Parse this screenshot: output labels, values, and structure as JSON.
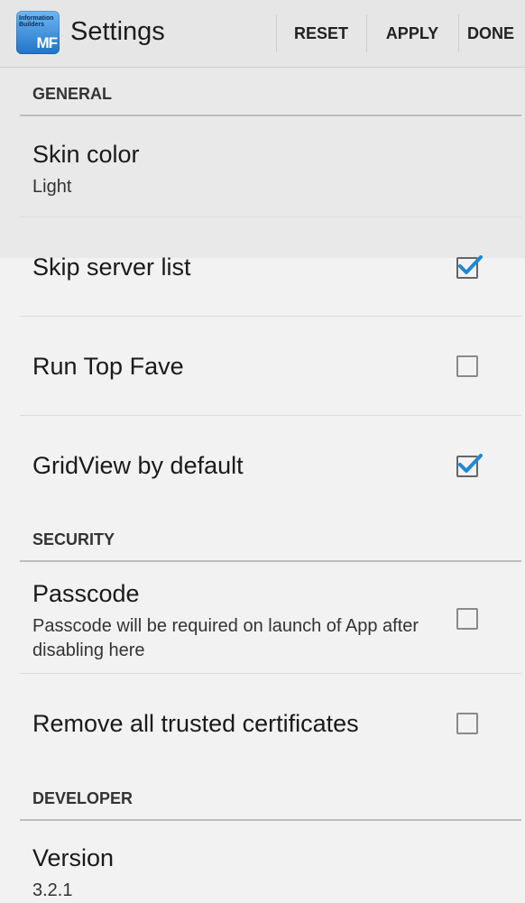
{
  "actionbar": {
    "title": "Settings",
    "icon": "information-builders-mf-icon",
    "icon_text_top": "Information Builders",
    "icon_text_mf": "MF",
    "actions": [
      "RESET",
      "APPLY",
      "DONE"
    ]
  },
  "colors": {
    "accent": "#1e88d6",
    "background": "#f2f2f2",
    "actionbar": "#e6e6e6"
  },
  "sections": [
    {
      "header": "GENERAL",
      "items": [
        {
          "title": "Skin color",
          "summary": "Light"
        },
        {
          "title": "Skip server list",
          "checked": true
        },
        {
          "title": "Run Top Fave",
          "checked": false
        },
        {
          "title": "GridView by default",
          "checked": true
        }
      ]
    },
    {
      "header": "SECURITY",
      "items": [
        {
          "title": "Passcode",
          "summary": "Passcode will be required on launch of App after disabling here",
          "checked": false
        },
        {
          "title": "Remove all trusted certificates",
          "checked": false
        }
      ]
    },
    {
      "header": "DEVELOPER",
      "items": [
        {
          "title": "Version",
          "summary": "3.2.1"
        }
      ]
    }
  ]
}
